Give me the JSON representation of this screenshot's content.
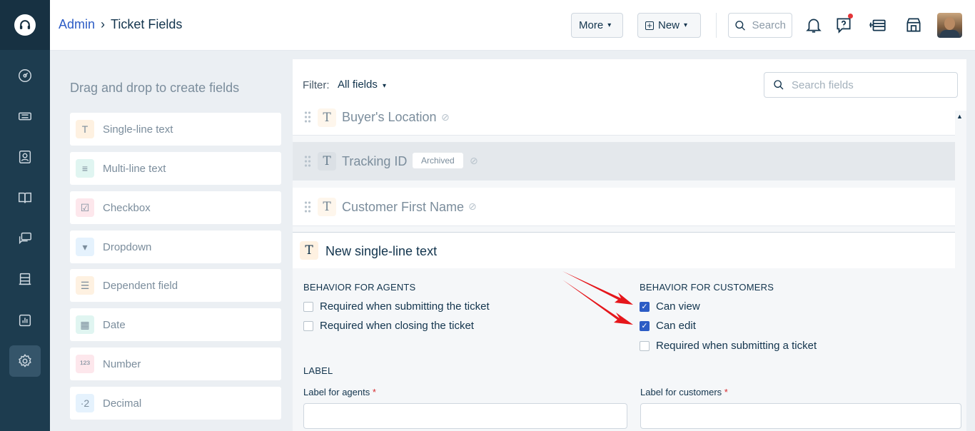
{
  "breadcrumb": {
    "parent": "Admin",
    "current": "Ticket Fields"
  },
  "toolbar": {
    "more_label": "More",
    "new_label": "New",
    "search_placeholder": "Search"
  },
  "palette": {
    "title": "Drag and drop to create fields",
    "items": [
      {
        "label": "Single-line text",
        "icon": "text-icon",
        "glyph": "T",
        "color": "#fef1e1"
      },
      {
        "label": "Multi-line text",
        "icon": "multiline-icon",
        "glyph": "≡",
        "color": "#e0f5f1"
      },
      {
        "label": "Checkbox",
        "icon": "checkbox-icon",
        "glyph": "☑",
        "color": "#fde7ec"
      },
      {
        "label": "Dropdown",
        "icon": "dropdown-icon",
        "glyph": "▾",
        "color": "#e5f2fd"
      },
      {
        "label": "Dependent field",
        "icon": "dependent-icon",
        "glyph": "☰",
        "color": "#fef1e1"
      },
      {
        "label": "Date",
        "icon": "calendar-icon",
        "glyph": "▦",
        "color": "#e0f5f1"
      },
      {
        "label": "Number",
        "icon": "number-icon",
        "glyph": "¹²³",
        "color": "#fde7ec"
      },
      {
        "label": "Decimal",
        "icon": "decimal-icon",
        "glyph": "·2",
        "color": "#e5f2fd"
      }
    ]
  },
  "filter": {
    "label": "Filter:",
    "value": "All fields",
    "search_placeholder": "Search fields"
  },
  "fields": [
    {
      "name": "Buyer's Location",
      "archived": false
    },
    {
      "name": "Tracking ID",
      "archived": true,
      "badge": "Archived"
    },
    {
      "name": "Customer First Name",
      "archived": false
    }
  ],
  "new_field": {
    "title": "New single-line text",
    "agents": {
      "title": "BEHAVIOR FOR AGENTS",
      "options": [
        {
          "label": "Required when submitting the ticket",
          "checked": false
        },
        {
          "label": "Required when closing the ticket",
          "checked": false
        }
      ]
    },
    "customers": {
      "title": "BEHAVIOR FOR CUSTOMERS",
      "options": [
        {
          "label": "Can view",
          "checked": true
        },
        {
          "label": "Can edit",
          "checked": true
        },
        {
          "label": "Required when submitting a ticket",
          "checked": false
        }
      ]
    },
    "label_section": "LABEL",
    "label_agents": "Label for agents",
    "label_customers": "Label for customers",
    "required_mark": "*"
  },
  "colors": {
    "accent": "#2c5cc5",
    "nav": "#1d3c4f",
    "annotation": "#e5161b"
  }
}
